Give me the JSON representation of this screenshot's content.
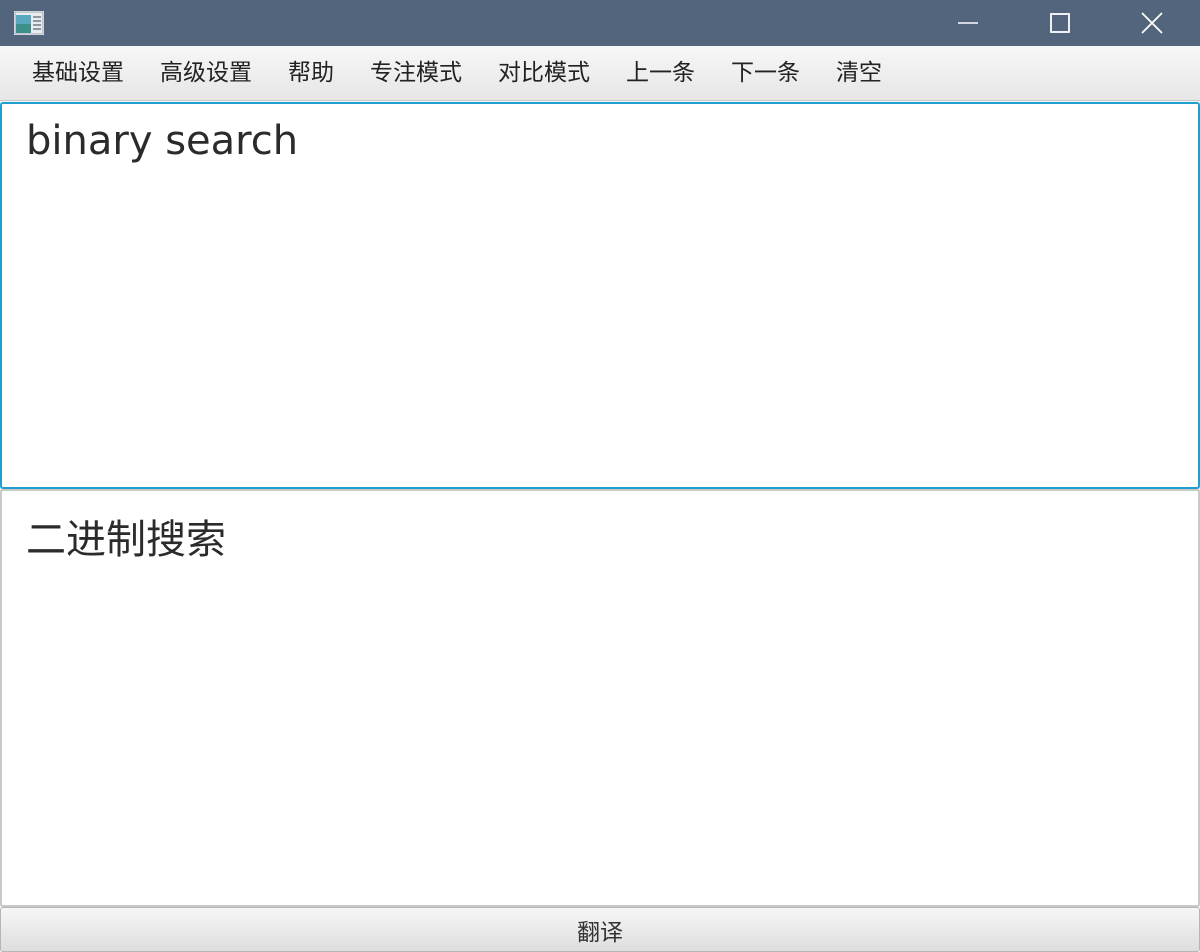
{
  "window": {
    "title_bar_color": "#52657c",
    "icons": {
      "app": "app-icon",
      "minimize": "minimize-icon",
      "maximize": "maximize-icon",
      "close": "close-icon"
    }
  },
  "menu": {
    "items": [
      {
        "label": "基础设置"
      },
      {
        "label": "高级设置"
      },
      {
        "label": "帮助"
      },
      {
        "label": "专注模式"
      },
      {
        "label": "对比模式"
      },
      {
        "label": "上一条"
      },
      {
        "label": "下一条"
      },
      {
        "label": "清空"
      }
    ]
  },
  "source": {
    "text": "binary search",
    "focus_color": "#1e9fd0"
  },
  "result": {
    "text": "二进制搜索"
  },
  "actions": {
    "translate_label": "翻译"
  }
}
